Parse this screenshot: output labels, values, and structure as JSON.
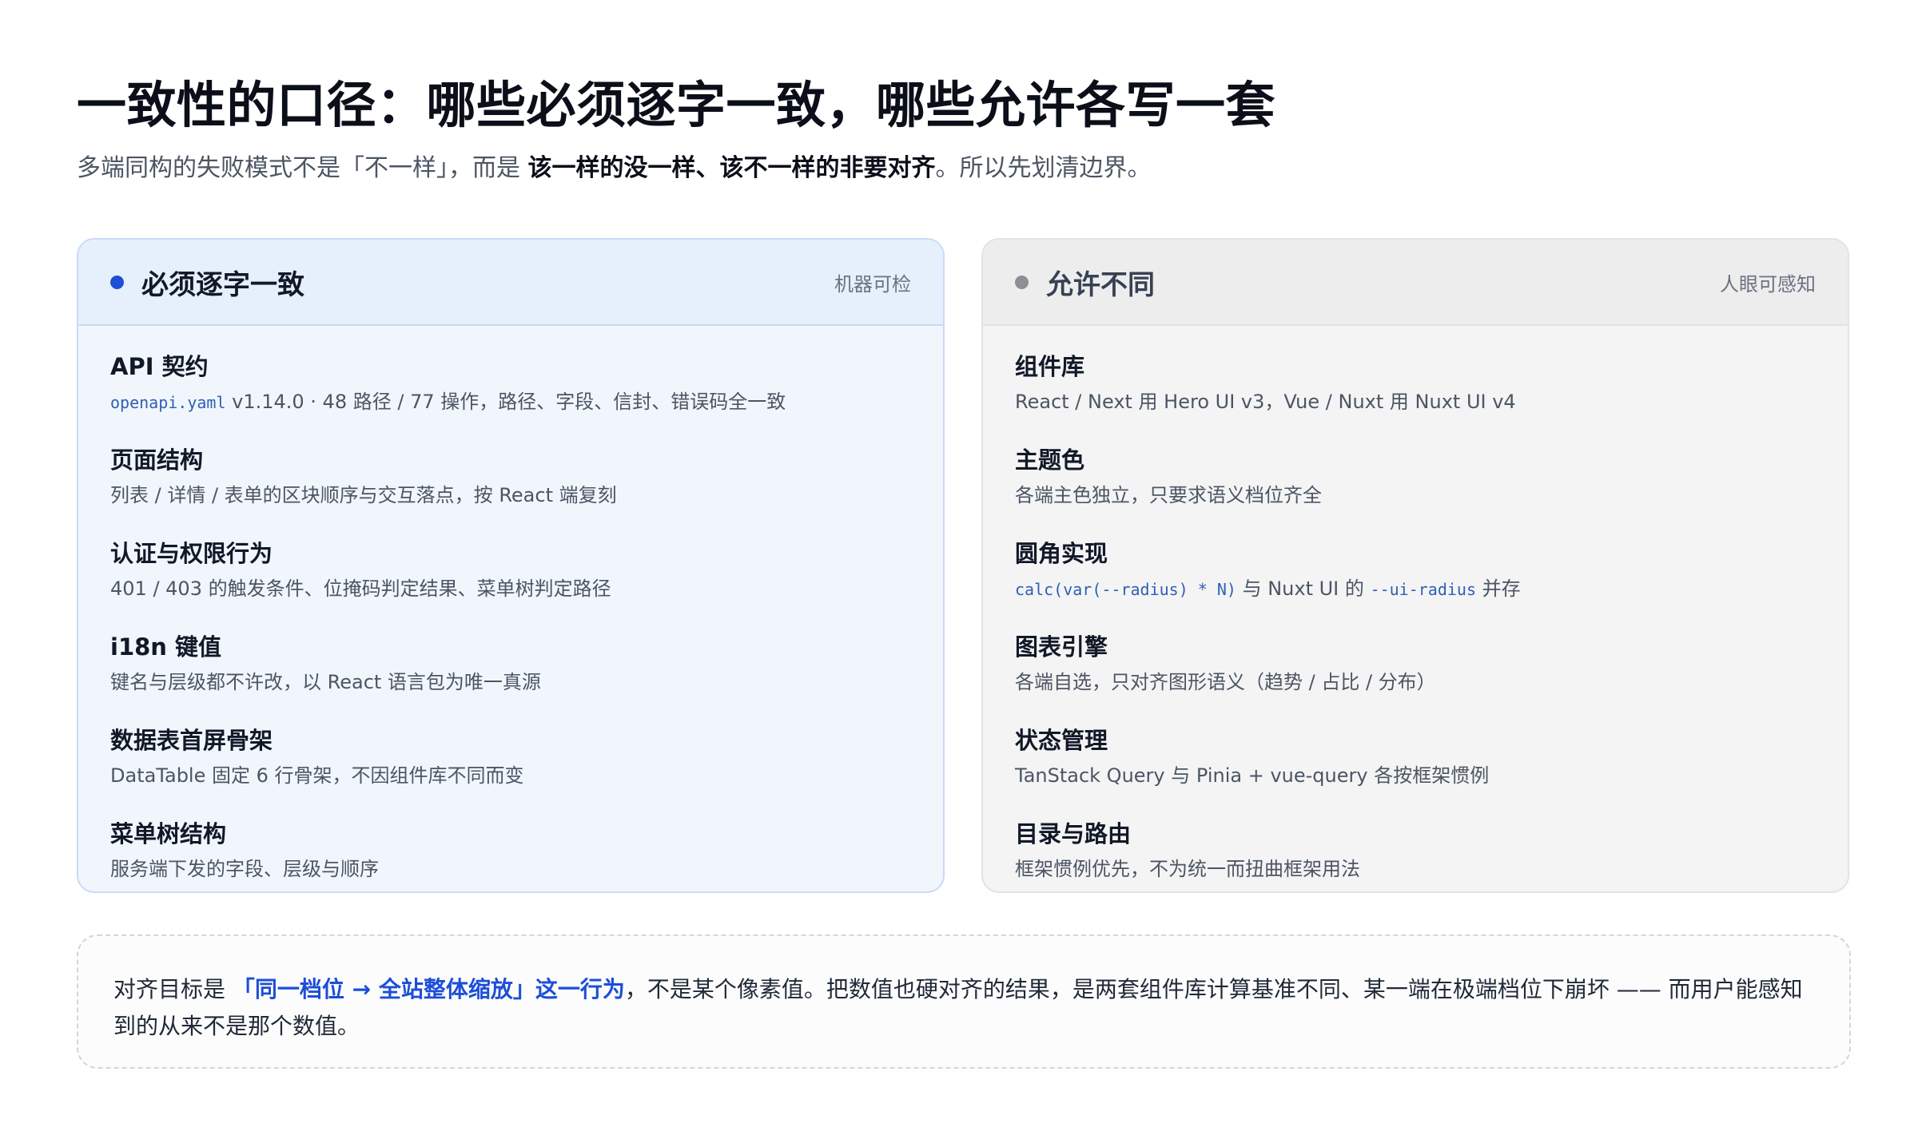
{
  "header": {
    "title": "一致性的口径：哪些必须逐字一致，哪些允许各写一套",
    "subtitle_pre": "多端同构的失败模式不是「不一样」，而是 ",
    "subtitle_strong": "该一样的没一样、该不一样的非要对齐",
    "subtitle_post": "。所以先划清边界。"
  },
  "colors": {
    "strict_dot": "#1d4ed8",
    "loose_dot": "#8c8f94",
    "highlight": "#1d4ed8",
    "code": "#2f5fb3"
  },
  "strict_card": {
    "title": "必须逐字一致",
    "tag": "机器可检",
    "items": [
      {
        "title": "API 契约",
        "code": "openapi.yaml",
        "desc": " v1.14.0 · 48 路径 / 77 操作，路径、字段、信封、错误码全一致"
      },
      {
        "title": "页面结构",
        "desc": "列表 / 详情 / 表单的区块顺序与交互落点，按 React 端复刻"
      },
      {
        "title": "认证与权限行为",
        "desc": "401 / 403 的触发条件、位掩码判定结果、菜单树判定路径"
      },
      {
        "title": "i18n 键值",
        "desc": "键名与层级都不许改，以 React 语言包为唯一真源"
      },
      {
        "title": "数据表首屏骨架",
        "desc": "DataTable 固定 6 行骨架，不因组件库不同而变"
      },
      {
        "title": "菜单树结构",
        "desc": "服务端下发的字段、层级与顺序"
      }
    ]
  },
  "loose_card": {
    "title": "允许不同",
    "tag": "人眼可感知",
    "items": [
      {
        "title": "组件库",
        "desc": "React / Next 用 Hero UI v3，Vue / Nuxt 用 Nuxt UI v4"
      },
      {
        "title": "主题色",
        "desc": "各端主色独立，只要求语义档位齐全"
      },
      {
        "title": "圆角实现",
        "code1": "calc(var(--radius) * N)",
        "mid": " 与 Nuxt UI 的 ",
        "code2": "--ui-radius",
        "post": " 并存"
      },
      {
        "title": "图表引擎",
        "desc": "各端自选，只对齐图形语义（趋势 / 占比 / 分布）"
      },
      {
        "title": "状态管理",
        "desc": "TanStack Query 与 Pinia + vue-query 各按框架惯例"
      },
      {
        "title": "目录与路由",
        "desc": "框架惯例优先，不为统一而扭曲框架用法"
      }
    ]
  },
  "callout": {
    "pre": "对齐目标是 ",
    "highlight": "「同一档位 → 全站整体缩放」这一行为",
    "post": "，不是某个像素值。把数值也硬对齐的结果，是两套组件库计算基准不同、某一端在极端档位下崩坏 —— 而用户能感知到的从来不是那个数值。"
  }
}
